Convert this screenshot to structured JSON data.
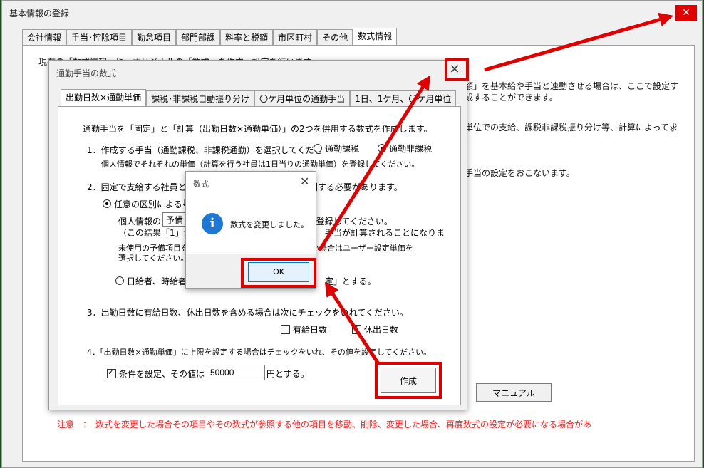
{
  "main_window": {
    "title": "基本情報の登録",
    "close_icon": "✕",
    "tabs": [
      "会社情報",
      "手当･控除項目",
      "勤怠項目",
      "部門部課",
      "料率と税額",
      "市区町村",
      "その他",
      "数式情報"
    ],
    "active_tab": "数式情報",
    "bg_texts": {
      "line1": "現在の「数式情報」や、オリジナルの「数式」を作成、設定を行います。",
      "line2": "額」を基本給や手当と連動させる場合は、ここで設定す",
      "line3": "成することができます。",
      "line4": "単位での支給、課税非課税振り分け等、計算によって求",
      "line5": "手当の設定をおこないます。"
    },
    "manual_button": "マニュアル",
    "warning": "注意　：　数式を変更した場合その項目やその数式が参照する他の項目を移動、削除、変更した場合、再度数式の設定が必要になる場合があ"
  },
  "dialog": {
    "title": "通勤手当の数式",
    "close_icon": "✕",
    "tabs": [
      "出勤日数×通勤単価",
      "課税･非課税自動振り分け",
      "〇ケ月単位の通勤手当",
      "1日、1ケ月、〇ケ月単位"
    ],
    "active_tab": "出勤日数×通勤単価",
    "intro": "通勤手当を「固定」と「計算（出勤日数×通勤単価）」の2つを併用する数式を作成します。",
    "step1": {
      "label": "1．作成する手当（通勤課税、非課税通勤）を選択してくださ",
      "option_taxable": "通勤課税",
      "option_nontaxable": "通勤非課税",
      "selected": "通勤非課税",
      "note": "個人情報でそれぞれの単価（計算を行う社員は1日当りの通勤単価）を登録してください。"
    },
    "step2": {
      "label": "2．固定で支給する社員と計",
      "label_tail": "社員を区別する必要があります。",
      "option_arbitrary": "任意の区別による",
      "arrow_glyph": "↓",
      "personal_info_prefix": "個人情報の",
      "personal_info_value": "予備",
      "register_tail": "に「1」を登録してください。",
      "result_prefix": "（この結果「1」が登",
      "result_tail": "手当が計算されることになりま",
      "unused_prefix": "未使用の予備項目を",
      "unused_tail": "ない場合はユーザー設定単価を",
      "choose": "選択してください。",
      "option_daily_prefix": "日給者、時給者を「",
      "option_daily_tail": "定」とする。"
    },
    "step3": {
      "label": "3．出勤日数に有給日数、休出日数を含める場合は次にチェックをいれてください。",
      "paid_days": "有給日数",
      "paid_checked": false,
      "holiday_days": "休出日数",
      "holiday_checked": true
    },
    "step4": {
      "label": "4．「出勤日数×通勤単価」に上限を設定する場合はチェックをいれ、その値を設定してください。",
      "checkbox_label": "条件を設定、その値は",
      "checked": true,
      "value": "50000",
      "suffix": "円とする。"
    },
    "create_button": "作成"
  },
  "message_box": {
    "title": "数式",
    "close_icon": "✕",
    "icon": "info-icon",
    "icon_glyph": "i",
    "text": "数式を変更しました。",
    "ok_button": "OK"
  },
  "colors": {
    "highlight": "#e00000",
    "warning": "#ff1a1a",
    "info_blue": "#1c78d4"
  }
}
